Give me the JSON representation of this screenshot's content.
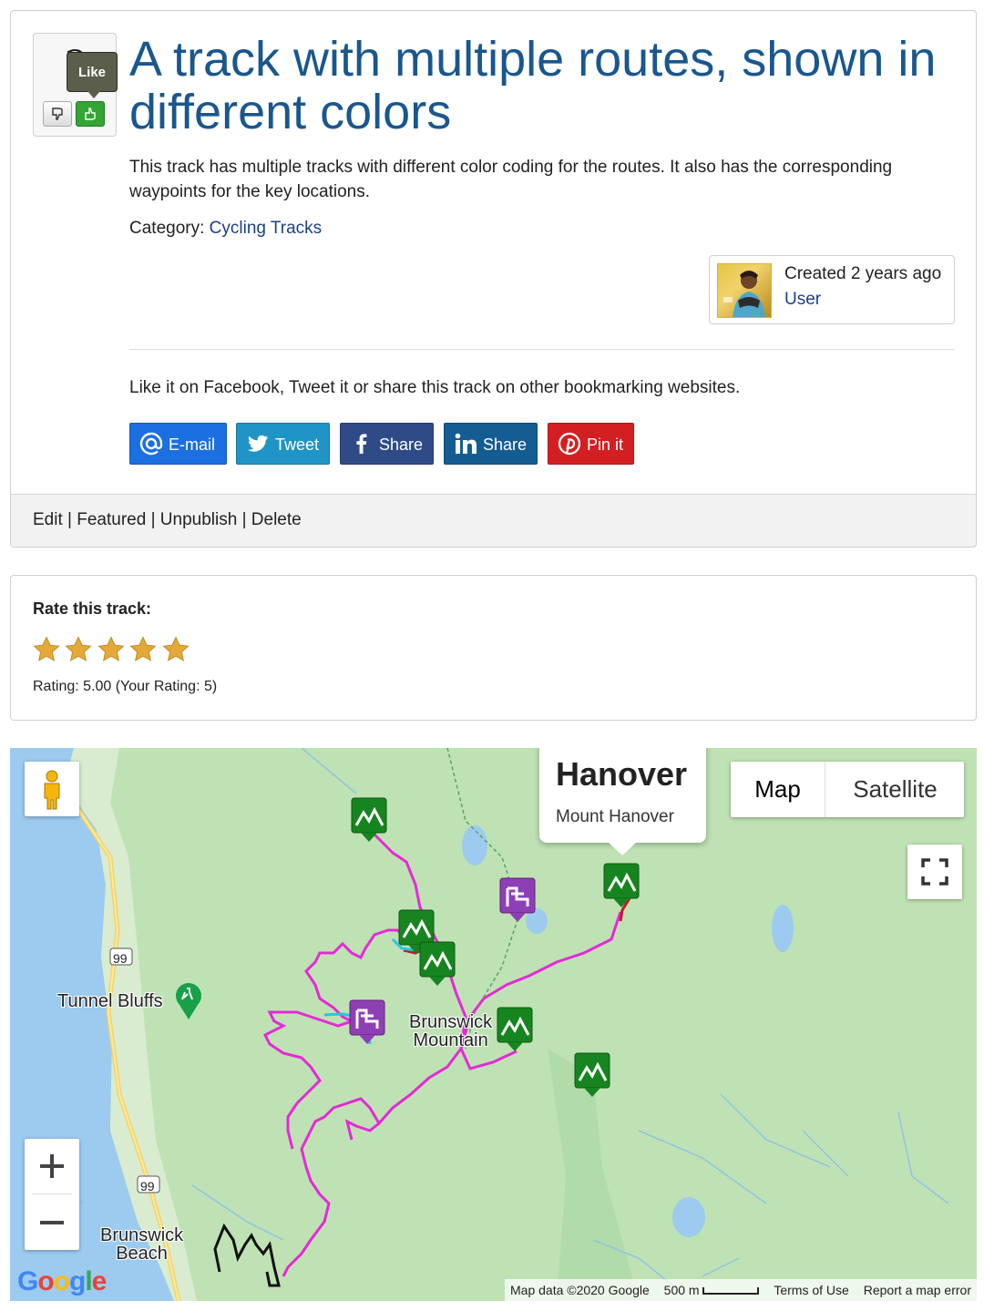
{
  "track": {
    "vote_count": "2",
    "like_tooltip": "Like",
    "title": "A track with multiple routes, shown in different colors",
    "description": "This track has multiple tracks with different color coding for the routes. It also has the corresponding waypoints for the key locations.",
    "category_label": "Category:",
    "category_value": "Cycling Tracks",
    "created": "Created 2 years ago",
    "author": "User",
    "share_prompt": "Like it on Facebook, Tweet it or share this track on other bookmarking websites."
  },
  "share_buttons": [
    {
      "label": "E-mail",
      "icon": "at-icon",
      "color": "#1b6fe0"
    },
    {
      "label": "Tweet",
      "icon": "twitter-icon",
      "color": "#2094c6"
    },
    {
      "label": "Share",
      "icon": "facebook-icon",
      "color": "#2f4b87"
    },
    {
      "label": "Share",
      "icon": "linkedin-icon",
      "color": "#145d92"
    },
    {
      "label": "Pin it",
      "icon": "pinterest-icon",
      "color": "#d41f22"
    }
  ],
  "actions": [
    "Edit",
    "Featured",
    "Unpublish",
    "Delete"
  ],
  "rating": {
    "title": "Rate this track:",
    "stars": 5,
    "max_stars": 5,
    "text": "Rating: 5.00 (Your Rating: 5)"
  },
  "map": {
    "info_title": "Hanover",
    "info_subtitle": "Mount Hanover",
    "map_type_map": "Map",
    "map_type_satellite": "Satellite",
    "zoom_in": "+",
    "zoom_out": "−",
    "labels": {
      "tunnel_bluffs": "Tunnel Bluffs",
      "brunswick_mountain_1": "Brunswick",
      "brunswick_mountain_2": "Mountain",
      "brunswick_beach_1": "Brunswick",
      "brunswick_beach_2": "Beach",
      "highway_1": "99",
      "highway_2": "99"
    },
    "attribution": {
      "data": "Map data ©2020 Google",
      "scale": "500 m",
      "terms": "Terms of Use",
      "report": "Report a map error"
    },
    "logo": "Google",
    "route_colors": [
      "#e629d8",
      "#c8152b",
      "#27c6e0",
      "#111111"
    ]
  }
}
